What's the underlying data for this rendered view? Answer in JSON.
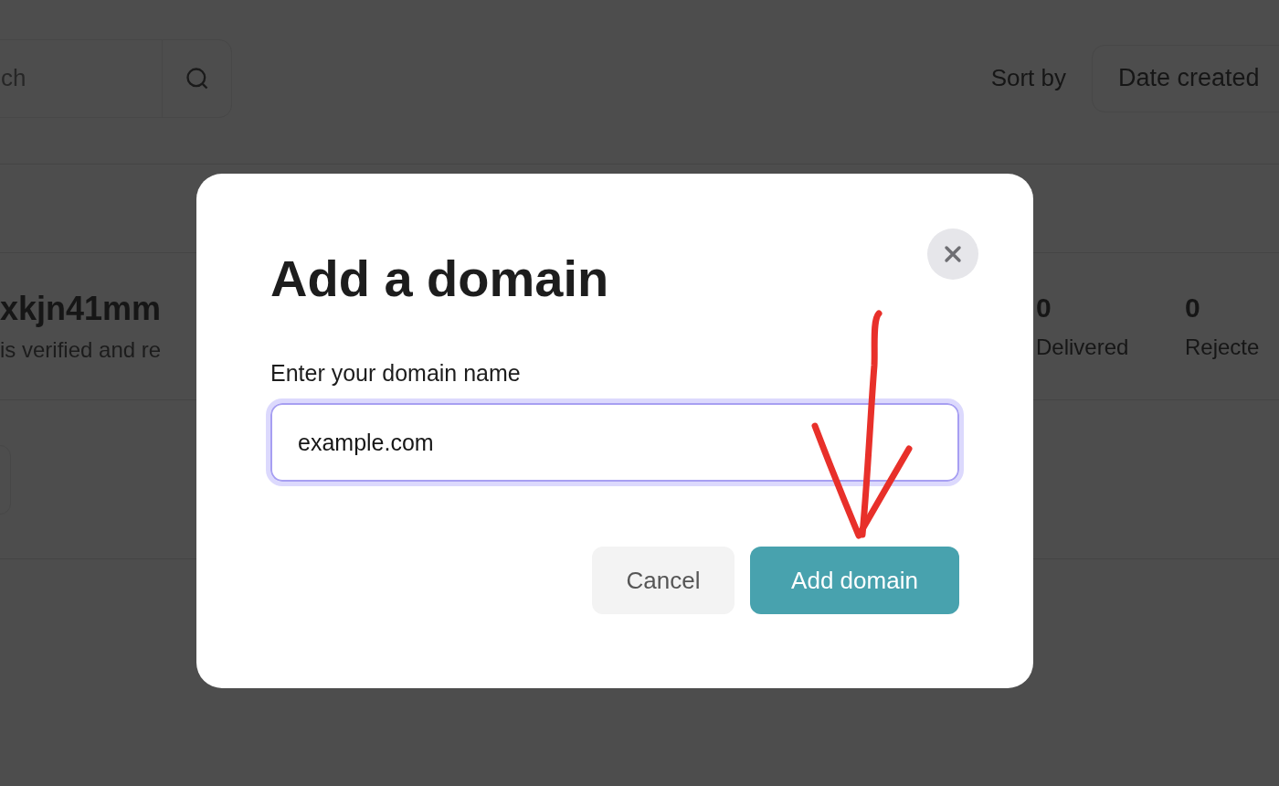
{
  "background": {
    "search": {
      "placeholder": "ch"
    },
    "sort": {
      "label": "Sort by",
      "value": "Date created"
    },
    "domain": {
      "name": "xkjn41mm",
      "description": "is verified and re",
      "stats": [
        {
          "value": "0",
          "label": "Delivered"
        },
        {
          "value": "0",
          "label": "Rejecte"
        }
      ]
    }
  },
  "dialog": {
    "title": "Add a domain",
    "field": {
      "label": "Enter your domain name",
      "value": "example.com"
    },
    "buttons": [
      {
        "label": "Cancel",
        "kind": "secondary"
      },
      {
        "label": "Add domain",
        "kind": "primary"
      }
    ]
  }
}
